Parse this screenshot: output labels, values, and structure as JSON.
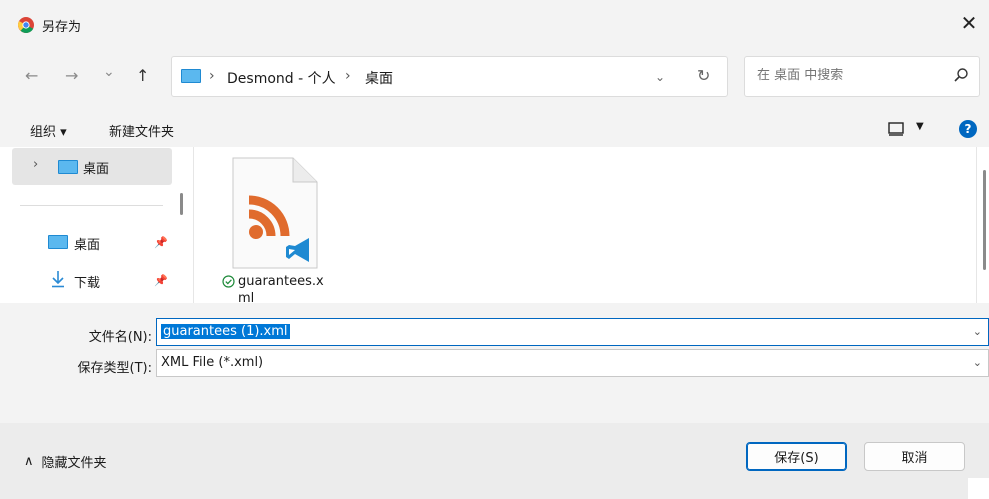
{
  "window": {
    "title": "另存为",
    "close": "✕"
  },
  "nav": {
    "back": "←",
    "forward": "→",
    "recent": "⌄",
    "up": "↑"
  },
  "address": {
    "sep1": "›",
    "crumb1": "Desmond - 个人",
    "sep2": "›",
    "crumb2": "桌面",
    "dropdown": "⌄",
    "refresh": "↻"
  },
  "search": {
    "placeholder": "在 桌面 中搜索"
  },
  "toolbar": {
    "organize": "组织 ▾",
    "new_folder": "新建文件夹",
    "view_dd": "▼",
    "help": "?"
  },
  "nav_pane": {
    "tree_expand": "›",
    "tree_item": "桌面",
    "quick_access": [
      {
        "label": "桌面",
        "pin": "📌"
      },
      {
        "label": "下载",
        "pin": "📌"
      }
    ]
  },
  "files": [
    {
      "name": "guarantees.xml"
    }
  ],
  "form": {
    "filename_label": "文件名(N):",
    "filename_value": "guarantees (1).xml",
    "filetype_label": "保存类型(T):",
    "filetype_value": "XML File (*.xml)",
    "dropdown": "⌄"
  },
  "footer": {
    "hide_folders_caret": "∧",
    "hide_folders": "隐藏文件夹",
    "save": "保存(S)",
    "cancel": "取消"
  },
  "colors": {
    "accent": "#0067c0",
    "rss": "#e06b2d",
    "vscode": "#1f8ad2"
  }
}
